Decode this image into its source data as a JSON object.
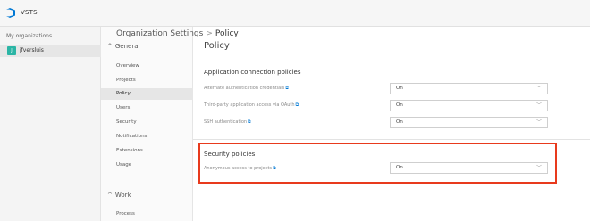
{
  "app": {
    "name": "VSTS"
  },
  "left_panel": {
    "heading": "My organizations",
    "org": {
      "badge": "J",
      "name": "jfversluis"
    }
  },
  "breadcrumb": {
    "parent": "Organization Settings",
    "separator": ">",
    "current": "Policy"
  },
  "nav": {
    "groups": [
      {
        "label": "General",
        "items": [
          "Overview",
          "Projects",
          "Policy",
          "Users",
          "Security",
          "Notifications",
          "Extensions",
          "Usage"
        ],
        "active": "Policy"
      },
      {
        "label": "Work",
        "items": [
          "Process"
        ]
      }
    ]
  },
  "page": {
    "title": "Policy",
    "sections": [
      {
        "title": "Application connection policies",
        "rows": [
          {
            "label": "Alternate authentication credentials",
            "value": "On"
          },
          {
            "label": "Third-party application access via OAuth",
            "value": "On"
          },
          {
            "label": "SSH authentication",
            "value": "On"
          }
        ]
      },
      {
        "title": "Security policies",
        "rows": [
          {
            "label": "Anonymous access to projects",
            "value": "On"
          }
        ]
      }
    ]
  },
  "colors": {
    "highlight": "#e83a1d",
    "link": "#0078d4",
    "org_badge": "#2bb5a5",
    "logo": "#0078d4"
  },
  "icons": {
    "logo": "vsts-logo-icon",
    "external_link": "external-link-icon",
    "dropdown": "chevron-down-icon",
    "collapse": "chevron-up-icon"
  }
}
